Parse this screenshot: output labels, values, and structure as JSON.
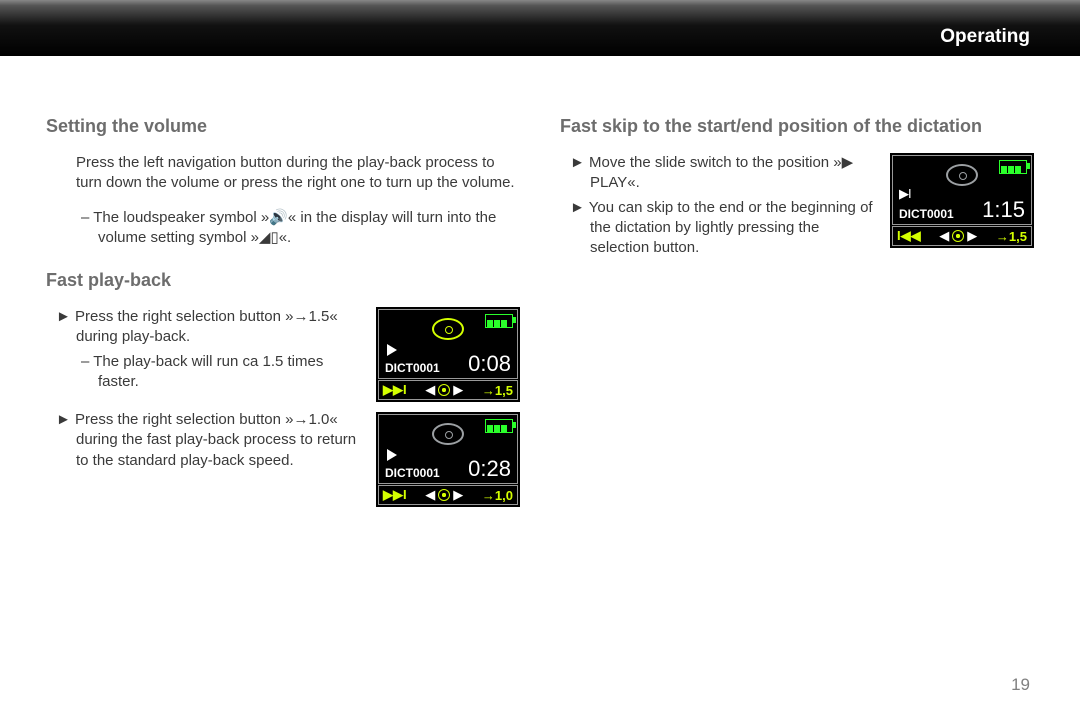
{
  "header": {
    "title": "Operating"
  },
  "page_number": "19",
  "left": {
    "sec1": {
      "heading": "Setting the volume",
      "para1": "Press the left navigation button during the play-back process to turn down the volume or press the right one to turn up the volume.",
      "sub1": "The loudspeaker symbol »🔊« in the display will turn into the volume setting symbol »◢▯«."
    },
    "sec2": {
      "heading": "Fast play-back",
      "item1": "Press the right selection button »→1.5« during play-back.",
      "sub1": "The play-back will run ca 1.5 times faster.",
      "item2": "Press the right selection button »→1.0« during the fast play-back process to return to the standard play-back speed."
    }
  },
  "right": {
    "sec1": {
      "heading": "Fast skip to the start/end position of the dictation",
      "item1": "Move the slide switch to the position »▶ PLAY«.",
      "item2": "You can skip to the end or the beginning of the dictation by lightly pressing the selection button."
    }
  },
  "lcd1": {
    "dict": "DICT0001",
    "time": "0:08",
    "bar_left": "▶▶I",
    "bar_mid_l": "◀",
    "bar_mid_r": "▶",
    "bar_right": "→1,5"
  },
  "lcd2": {
    "dict": "DICT0001",
    "time": "0:28",
    "bar_left": "▶▶I",
    "bar_mid_l": "◀",
    "bar_mid_r": "▶",
    "bar_right": "→1,0"
  },
  "lcd3": {
    "dict": "DICT0001",
    "time": "1:15",
    "bar_left": "I◀◀",
    "bar_mid_l": "◀",
    "bar_mid_r": "▶",
    "bar_right": "→1,5"
  }
}
